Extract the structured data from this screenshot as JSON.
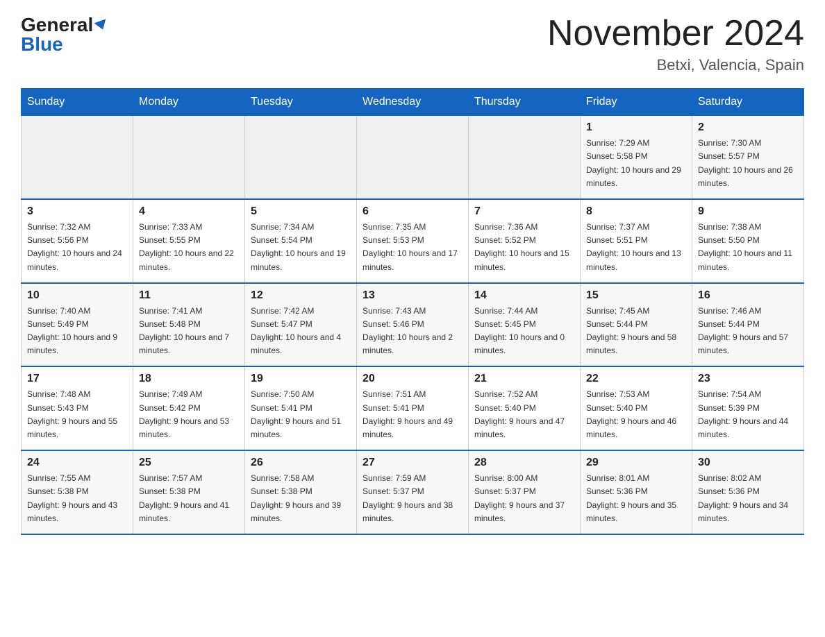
{
  "header": {
    "logo_line1": "General",
    "logo_line2": "Blue",
    "title": "November 2024",
    "subtitle": "Betxi, Valencia, Spain"
  },
  "weekdays": [
    "Sunday",
    "Monday",
    "Tuesday",
    "Wednesday",
    "Thursday",
    "Friday",
    "Saturday"
  ],
  "weeks": [
    [
      {
        "day": "",
        "info": ""
      },
      {
        "day": "",
        "info": ""
      },
      {
        "day": "",
        "info": ""
      },
      {
        "day": "",
        "info": ""
      },
      {
        "day": "",
        "info": ""
      },
      {
        "day": "1",
        "info": "Sunrise: 7:29 AM\nSunset: 5:58 PM\nDaylight: 10 hours and 29 minutes."
      },
      {
        "day": "2",
        "info": "Sunrise: 7:30 AM\nSunset: 5:57 PM\nDaylight: 10 hours and 26 minutes."
      }
    ],
    [
      {
        "day": "3",
        "info": "Sunrise: 7:32 AM\nSunset: 5:56 PM\nDaylight: 10 hours and 24 minutes."
      },
      {
        "day": "4",
        "info": "Sunrise: 7:33 AM\nSunset: 5:55 PM\nDaylight: 10 hours and 22 minutes."
      },
      {
        "day": "5",
        "info": "Sunrise: 7:34 AM\nSunset: 5:54 PM\nDaylight: 10 hours and 19 minutes."
      },
      {
        "day": "6",
        "info": "Sunrise: 7:35 AM\nSunset: 5:53 PM\nDaylight: 10 hours and 17 minutes."
      },
      {
        "day": "7",
        "info": "Sunrise: 7:36 AM\nSunset: 5:52 PM\nDaylight: 10 hours and 15 minutes."
      },
      {
        "day": "8",
        "info": "Sunrise: 7:37 AM\nSunset: 5:51 PM\nDaylight: 10 hours and 13 minutes."
      },
      {
        "day": "9",
        "info": "Sunrise: 7:38 AM\nSunset: 5:50 PM\nDaylight: 10 hours and 11 minutes."
      }
    ],
    [
      {
        "day": "10",
        "info": "Sunrise: 7:40 AM\nSunset: 5:49 PM\nDaylight: 10 hours and 9 minutes."
      },
      {
        "day": "11",
        "info": "Sunrise: 7:41 AM\nSunset: 5:48 PM\nDaylight: 10 hours and 7 minutes."
      },
      {
        "day": "12",
        "info": "Sunrise: 7:42 AM\nSunset: 5:47 PM\nDaylight: 10 hours and 4 minutes."
      },
      {
        "day": "13",
        "info": "Sunrise: 7:43 AM\nSunset: 5:46 PM\nDaylight: 10 hours and 2 minutes."
      },
      {
        "day": "14",
        "info": "Sunrise: 7:44 AM\nSunset: 5:45 PM\nDaylight: 10 hours and 0 minutes."
      },
      {
        "day": "15",
        "info": "Sunrise: 7:45 AM\nSunset: 5:44 PM\nDaylight: 9 hours and 58 minutes."
      },
      {
        "day": "16",
        "info": "Sunrise: 7:46 AM\nSunset: 5:44 PM\nDaylight: 9 hours and 57 minutes."
      }
    ],
    [
      {
        "day": "17",
        "info": "Sunrise: 7:48 AM\nSunset: 5:43 PM\nDaylight: 9 hours and 55 minutes."
      },
      {
        "day": "18",
        "info": "Sunrise: 7:49 AM\nSunset: 5:42 PM\nDaylight: 9 hours and 53 minutes."
      },
      {
        "day": "19",
        "info": "Sunrise: 7:50 AM\nSunset: 5:41 PM\nDaylight: 9 hours and 51 minutes."
      },
      {
        "day": "20",
        "info": "Sunrise: 7:51 AM\nSunset: 5:41 PM\nDaylight: 9 hours and 49 minutes."
      },
      {
        "day": "21",
        "info": "Sunrise: 7:52 AM\nSunset: 5:40 PM\nDaylight: 9 hours and 47 minutes."
      },
      {
        "day": "22",
        "info": "Sunrise: 7:53 AM\nSunset: 5:40 PM\nDaylight: 9 hours and 46 minutes."
      },
      {
        "day": "23",
        "info": "Sunrise: 7:54 AM\nSunset: 5:39 PM\nDaylight: 9 hours and 44 minutes."
      }
    ],
    [
      {
        "day": "24",
        "info": "Sunrise: 7:55 AM\nSunset: 5:38 PM\nDaylight: 9 hours and 43 minutes."
      },
      {
        "day": "25",
        "info": "Sunrise: 7:57 AM\nSunset: 5:38 PM\nDaylight: 9 hours and 41 minutes."
      },
      {
        "day": "26",
        "info": "Sunrise: 7:58 AM\nSunset: 5:38 PM\nDaylight: 9 hours and 39 minutes."
      },
      {
        "day": "27",
        "info": "Sunrise: 7:59 AM\nSunset: 5:37 PM\nDaylight: 9 hours and 38 minutes."
      },
      {
        "day": "28",
        "info": "Sunrise: 8:00 AM\nSunset: 5:37 PM\nDaylight: 9 hours and 37 minutes."
      },
      {
        "day": "29",
        "info": "Sunrise: 8:01 AM\nSunset: 5:36 PM\nDaylight: 9 hours and 35 minutes."
      },
      {
        "day": "30",
        "info": "Sunrise: 8:02 AM\nSunset: 5:36 PM\nDaylight: 9 hours and 34 minutes."
      }
    ]
  ]
}
